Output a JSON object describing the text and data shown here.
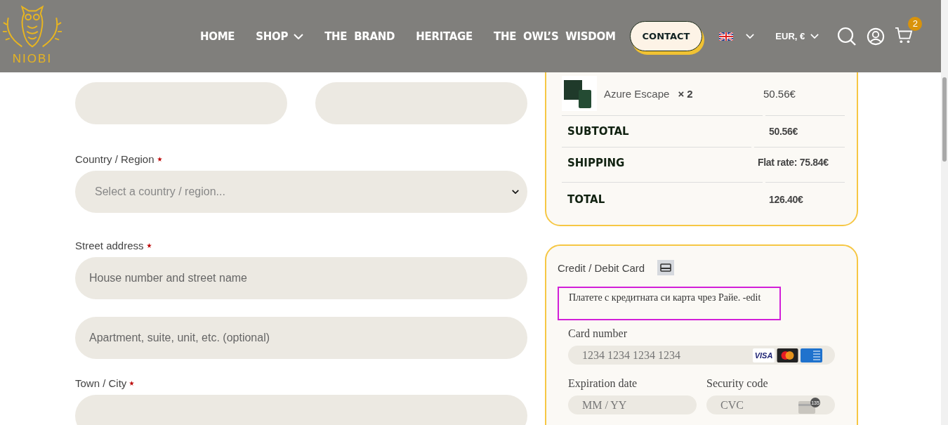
{
  "header": {
    "logo_text": "NIOBI",
    "nav": [
      {
        "label": "HOME",
        "has_dropdown": false
      },
      {
        "label": "SHOP",
        "has_dropdown": true
      },
      {
        "label": "THE  BRAND",
        "has_dropdown": false
      },
      {
        "label": "HERITAGE",
        "has_dropdown": false
      },
      {
        "label": "THE  OWL’S  WISDOM",
        "has_dropdown": false
      }
    ],
    "contact_button": "CONTACT",
    "currency": "EUR, €",
    "cart_count": "2"
  },
  "form": {
    "fields": [
      {
        "kind": "half"
      },
      {
        "kind": "half"
      },
      {
        "kind": "select",
        "label": "Country / Region",
        "required": true,
        "placeholder": "Select a country / region..."
      },
      {
        "kind": "full",
        "label": "Street address",
        "required": true,
        "placeholder": "House number and street name"
      },
      {
        "kind": "full",
        "placeholder": "Apartment, suite, unit, etc. (optional)"
      },
      {
        "kind": "full",
        "label": "Town / City",
        "required": true
      }
    ]
  },
  "order_summary": {
    "item": {
      "name": "Azure Escape",
      "quantity": "× 2",
      "price": "50.56€"
    },
    "rows": [
      {
        "label": "SUBTOTAL",
        "value": "50.56€"
      },
      {
        "label": "SHIPPING",
        "value": "Flat rate: 75.84€"
      },
      {
        "label": "TOTAL",
        "value": "126.40€"
      }
    ]
  },
  "payment": {
    "method": "Credit / Debit Card",
    "description": "Платете с кредитната си карта чрез Райе. -edit",
    "card_number": {
      "label": "Card number",
      "placeholder": "1234 1234 1234 1234"
    },
    "card_brands": [
      {
        "kind": "visa",
        "text": "VISA"
      },
      {
        "kind": "mastercard"
      },
      {
        "kind": "amex"
      }
    ],
    "expiry": {
      "label": "Expiration date",
      "placeholder": "MM / YY"
    },
    "cvc": {
      "label": "Security code",
      "placeholder": "CVC",
      "badge": "135"
    }
  }
}
